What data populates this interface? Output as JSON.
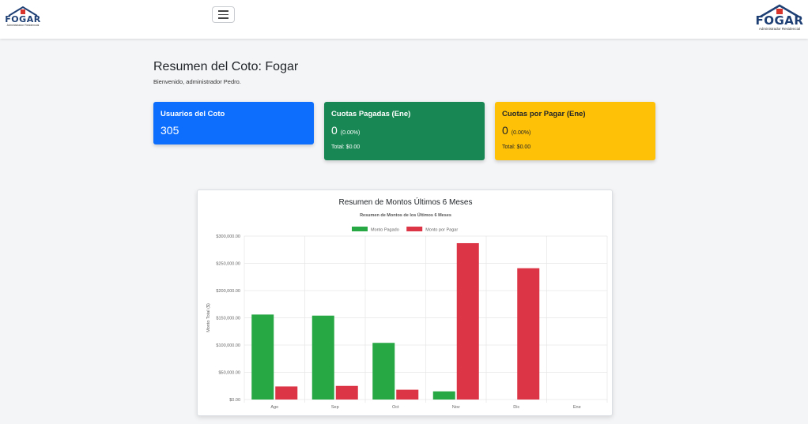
{
  "navbar": {
    "logo_left": {
      "name": "FOGAR",
      "tagline": "Administrador Residencial"
    },
    "logo_right": {
      "name": "FOGAR",
      "tagline": "Administrador Residencial"
    }
  },
  "header": {
    "title": "Resumen del Coto: Fogar",
    "welcome": "Bienvenido, administrador Pedro."
  },
  "cards": {
    "users": {
      "title": "Usuarios del Coto",
      "value": "305",
      "color": "#0d6efd"
    },
    "paid": {
      "title": "Cuotas Pagadas (Ene)",
      "value": "0",
      "percent": "(0.00%)",
      "total": "Total: $0.00",
      "color": "#198754"
    },
    "pending": {
      "title": "Cuotas por Pagar (Ene)",
      "value": "0",
      "percent": "(0.00%)",
      "total": "Total: $0.00",
      "color": "#ffc107"
    }
  },
  "chart_card": {
    "header": "Resumen de Montos Últimos 6 Meses"
  },
  "chart_data": {
    "type": "bar",
    "title": "Resumen de Montos de los Últimos 6 Meses",
    "xlabel": "",
    "ylabel": "Monto Total ($)",
    "categories": [
      "Ago",
      "Sep",
      "Oct",
      "Nov",
      "Dic",
      "Ene"
    ],
    "series": [
      {
        "name": "Monto Pagado",
        "color": "#28a745",
        "values": [
          156000,
          154000,
          104000,
          15000,
          0,
          0
        ]
      },
      {
        "name": "Monto por Pagar",
        "color": "#dc3545",
        "values": [
          24000,
          25000,
          18000,
          287000,
          241000,
          0
        ]
      }
    ],
    "ylim": [
      0,
      300000
    ],
    "yticks": [
      0,
      50000,
      100000,
      150000,
      200000,
      250000,
      300000
    ],
    "ytick_labels": [
      "$0.00",
      "$50,000.00",
      "$100,000.00",
      "$150,000.00",
      "$200,000.00",
      "$250,000.00",
      "$300,000.00"
    ],
    "grid": true,
    "legend_position": "top"
  }
}
